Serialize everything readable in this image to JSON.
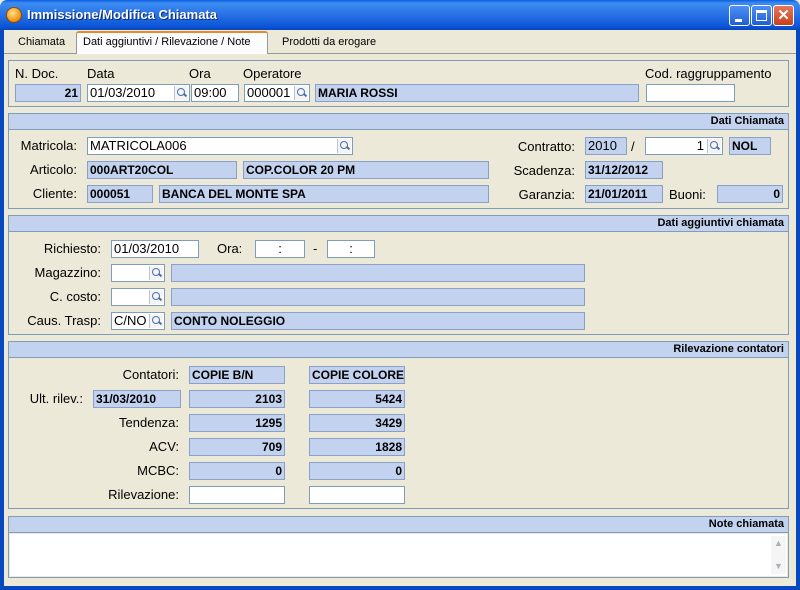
{
  "window": {
    "title": "Immissione/Modifica Chiamata",
    "app_icon": "app-icon",
    "close_glyph": "✕"
  },
  "tabs": [
    {
      "label": "Chiamata",
      "active": false
    },
    {
      "label": "Dati aggiuntivi / Rilevazione / Note",
      "active": true
    },
    {
      "label": "Prodotti da erogare",
      "active": false
    }
  ],
  "header": {
    "n_doc_label": "N. Doc.",
    "n_doc": "21",
    "data_label": "Data",
    "data": "01/03/2010",
    "ora_label": "Ora",
    "ora": "09:00",
    "operatore_label": "Operatore",
    "operatore_code": "000001",
    "operatore_name": "MARIA ROSSI",
    "cod_raggr_label": "Cod. raggruppamento",
    "cod_raggr": ""
  },
  "dati_chiamata": {
    "title": "Dati Chiamata",
    "matricola_label": "Matricola:",
    "matricola": "MATRICOLA006",
    "contratto_label": "Contratto:",
    "contratto_anno": "2010",
    "contratto_sep": "/",
    "contratto_num": "1",
    "contratto_tipo": "NOL",
    "articolo_label": "Articolo:",
    "articolo_code": "000ART20COL",
    "articolo_desc": "COP.COLOR 20 PM",
    "scadenza_label": "Scadenza:",
    "scadenza": "31/12/2012",
    "cliente_label": "Cliente:",
    "cliente_code": "000051",
    "cliente_name": "BANCA DEL MONTE SPA",
    "garanzia_label": "Garanzia:",
    "garanzia": "21/01/2011",
    "buoni_label": "Buoni:",
    "buoni": "0"
  },
  "dati_aggiuntivi": {
    "title": "Dati aggiuntivi chiamata",
    "richiesto_label": "Richiesto:",
    "richiesto": "01/03/2010",
    "ora_label": "Ora:",
    "ora_da": "  :  ",
    "ora_sep": "-",
    "ora_a": "  :  ",
    "magazzino_label": "Magazzino:",
    "magazzino_code": "",
    "magazzino_desc": "",
    "ccosto_label": "C. costo:",
    "ccosto_code": "",
    "ccosto_desc": "",
    "caus_label": "Caus. Trasp:",
    "caus_code": "C/NO",
    "caus_desc": "CONTO NOLEGGIO"
  },
  "rilevazione": {
    "title": "Rilevazione contatori",
    "contatori_label": "Contatori:",
    "col_bn": "COPIE B/N",
    "col_colore": "COPIE COLORE",
    "ult_rilev_label": "Ult. rilev.:",
    "ult_rilev_date": "31/03/2010",
    "ult_bn": "2103",
    "ult_col": "5424",
    "tendenza_label": "Tendenza:",
    "tend_bn": "1295",
    "tend_col": "3429",
    "acv_label": "ACV:",
    "acv_bn": "709",
    "acv_col": "1828",
    "mcbc_label": "MCBC:",
    "mcbc_bn": "0",
    "mcbc_col": "0",
    "rilevazione_label": "Rilevazione:",
    "ril_bn": "",
    "ril_col": ""
  },
  "note": {
    "title": "Note chiamata",
    "text": "",
    "up_arrow": "▲",
    "down_arrow": "▼"
  }
}
